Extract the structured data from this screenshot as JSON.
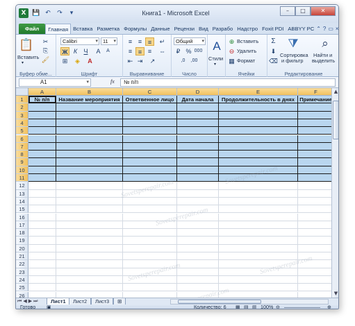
{
  "window": {
    "app_icon": "X",
    "title": "Книга1 - Microsoft Excel",
    "minimize": "–",
    "maximize": "□",
    "close": "✕"
  },
  "qat": {
    "save": "💾",
    "undo": "↶",
    "redo": "↷",
    "customize": "▾"
  },
  "tabs": [
    {
      "label": "Файл",
      "kind": "file"
    },
    {
      "label": "Главная",
      "kind": "active"
    },
    {
      "label": "Вставка",
      "kind": ""
    },
    {
      "label": "Разметка",
      "kind": ""
    },
    {
      "label": "Формулы",
      "kind": ""
    },
    {
      "label": "Данные",
      "kind": ""
    },
    {
      "label": "Рецензи",
      "kind": ""
    },
    {
      "label": "Вид",
      "kind": ""
    },
    {
      "label": "Разрабо",
      "kind": ""
    },
    {
      "label": "Надстро",
      "kind": ""
    },
    {
      "label": "Foxit PDI",
      "kind": ""
    },
    {
      "label": "ABBYY PC",
      "kind": ""
    }
  ],
  "ribbon": {
    "clipboard": {
      "label": "Буфер обме...",
      "paste": "Вставить"
    },
    "font": {
      "label": "Шрифт",
      "name": "Calibri",
      "size": "11",
      "bold": "Ж",
      "italic": "К",
      "underline": "Ч"
    },
    "alignment": {
      "label": "Выравнивание"
    },
    "number": {
      "label": "Число",
      "format": "Общий",
      "percent": "%",
      "thousands": "000"
    },
    "styles": {
      "label": "Стили",
      "button": "Стили"
    },
    "cells": {
      "label": "Ячейки",
      "insert": "Вставить",
      "delete": "Удалить",
      "format": "Формат"
    },
    "editing": {
      "label": "Редактирование",
      "sort": "Сортировка",
      "sort2": "и фильтр",
      "find": "Найти и",
      "find2": "выделить"
    }
  },
  "formula": {
    "namebox": "A1",
    "fx": "fx",
    "value": "№ п/п"
  },
  "grid": {
    "columns": [
      "A",
      "B",
      "C",
      "D",
      "E",
      "F"
    ],
    "headers": [
      "№ п/п",
      "Название мероприятия",
      "Ответвенное лицо",
      "Дата начала",
      "Продолжительность в днях",
      "Примечание"
    ],
    "rows": [
      "1",
      "2",
      "3",
      "4",
      "5",
      "6",
      "7",
      "8",
      "9",
      "10",
      "11",
      "12",
      "13",
      "14",
      "15",
      "16",
      "17",
      "18",
      "19",
      "20",
      "21",
      "22",
      "23",
      "24",
      "25",
      "26"
    ],
    "watermark": "Sovetsperepair.com"
  },
  "sheets": [
    "Лист1",
    "Лист2",
    "Лист3"
  ],
  "status": {
    "ready": "Готово",
    "count": "Количество: 6",
    "zoom": "100%"
  }
}
